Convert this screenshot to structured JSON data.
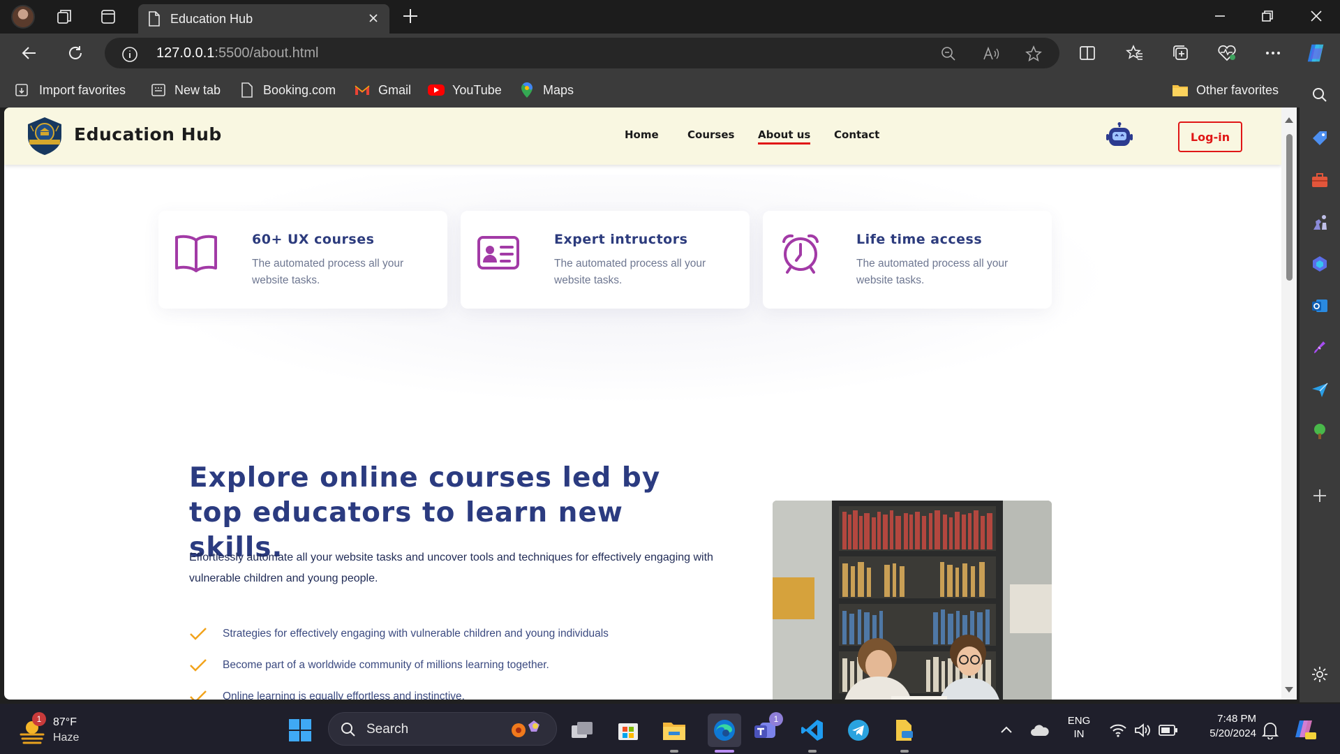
{
  "browser": {
    "tab_title": "Education Hub",
    "url_host": "127.0.0.1",
    "url_rest": ":5500/about.html",
    "bookmarks": [
      "Import favorites",
      "New tab",
      "Booking.com",
      "Gmail",
      "YouTube",
      "Maps"
    ],
    "other_favorites": "Other favorites"
  },
  "site": {
    "brand": "Education Hub",
    "nav": {
      "home": "Home",
      "courses": "Courses",
      "about": "About us",
      "contact": "Contact"
    },
    "login": "Log-in",
    "features": [
      {
        "icon": "book-icon",
        "title": "60+ UX courses",
        "desc": "The automated process all your website tasks."
      },
      {
        "icon": "id-card-icon",
        "title": "Expert intructors",
        "desc": "The automated process all your website tasks."
      },
      {
        "icon": "alarm-clock-icon",
        "title": "Life time access",
        "desc": "The automated process all your website tasks."
      }
    ],
    "hero_title": "Explore online courses led by top educators to learn new skills.",
    "hero_text": "Effortlessly automate all your website tasks and uncover tools and techniques for effectively engaging with vulnerable children and young people.",
    "checklist": [
      "Strategies for effectively engaging with vulnerable children and young individuals",
      "Become part of a worldwide community of millions learning together.",
      "Online learning is equally effortless and instinctive."
    ],
    "accent_color": "#e01616",
    "title_color": "#2b3b80",
    "icon_color": "#a23aa6",
    "check_color": "#f2a31b"
  },
  "taskbar": {
    "weather_temp": "87°F",
    "weather_cond": "Haze",
    "weather_badge": "1",
    "search_label": "Search",
    "teams_badge": "1",
    "lang_line1": "ENG",
    "lang_line2": "IN",
    "time": "7:48 PM",
    "date": "5/20/2024"
  }
}
